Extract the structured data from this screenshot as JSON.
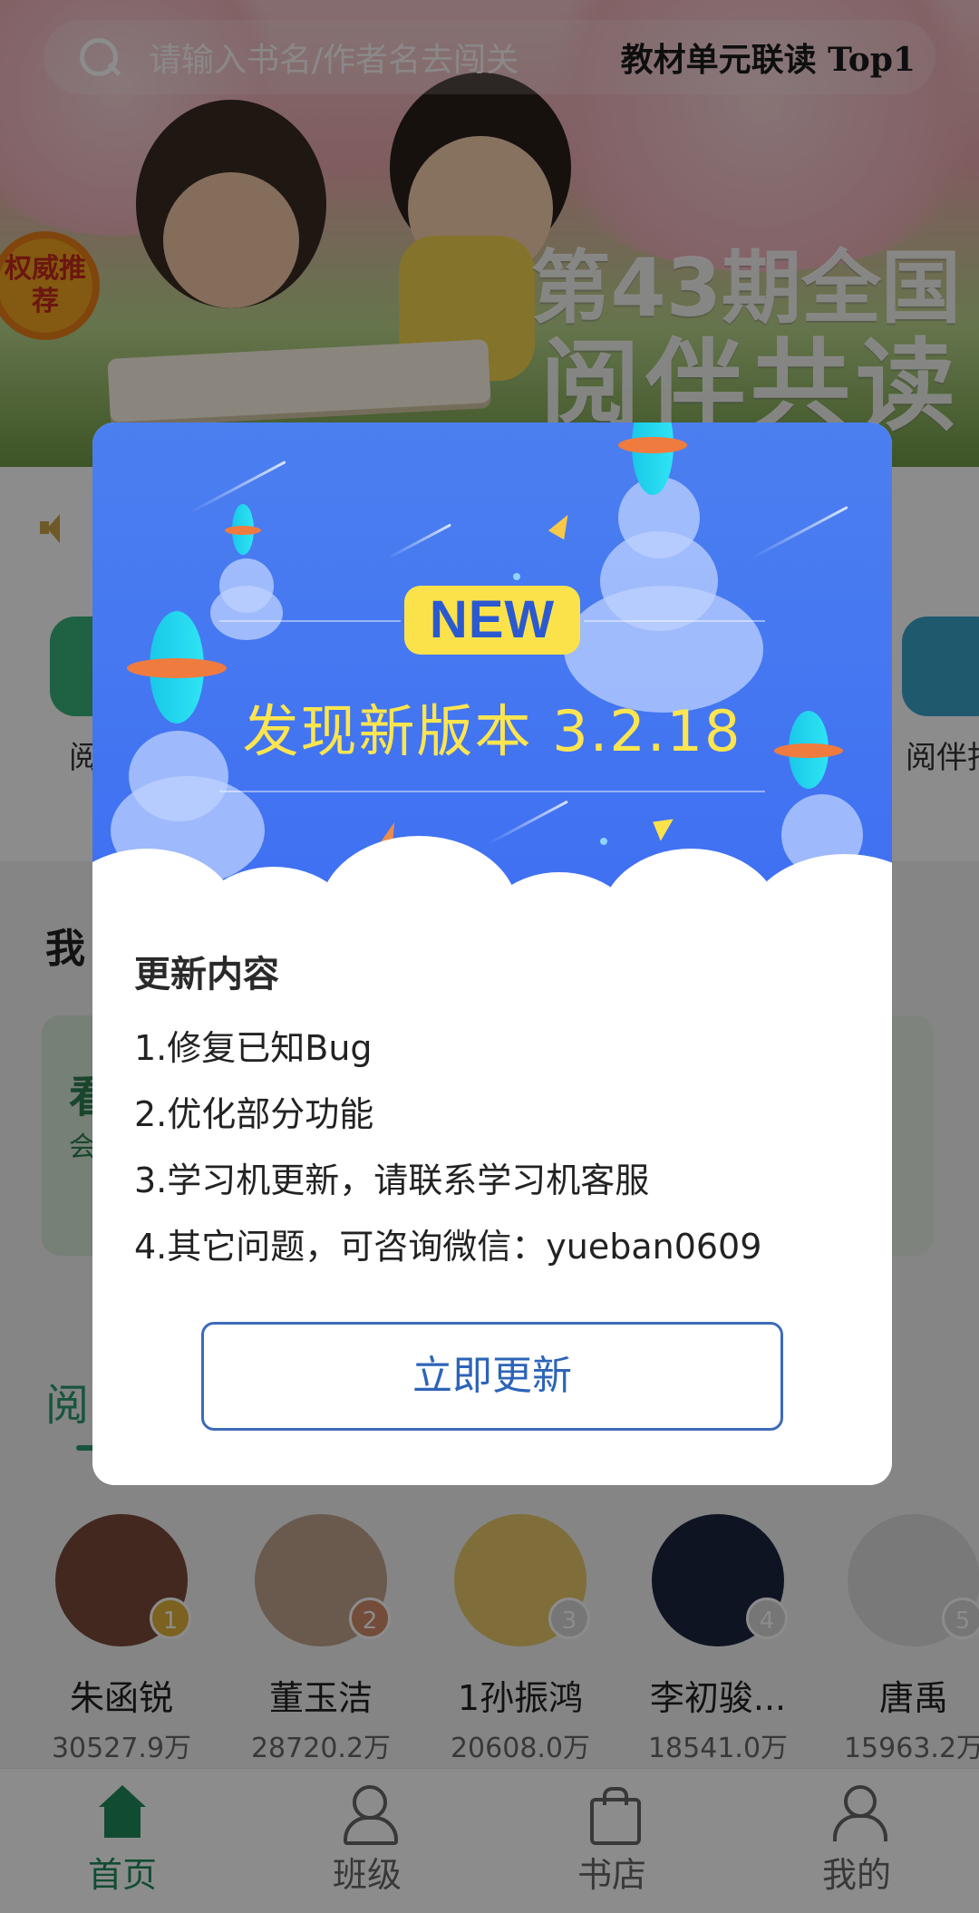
{
  "search": {
    "placeholder": "请输入书名/作者名去闯关",
    "hot_text": "教材单元联读 Top1"
  },
  "banner": {
    "badge": "权威推荐",
    "title_line1": "第43期全国",
    "title_line2": "阅伴共读"
  },
  "shortcuts": [
    {
      "label": "阅伴",
      "icon": "reading-icon",
      "color": "#39b27a"
    },
    {
      "label": "阅伴指",
      "icon": "guide-icon",
      "color": "#3aa2c9"
    }
  ],
  "section": {
    "title": "我",
    "card_text": "看",
    "card_sub": "会"
  },
  "rank_tab": "阅",
  "ranks": [
    {
      "rank": "1",
      "name": "朱函锐",
      "score": "30527.9万",
      "badge_color": "#e2b23b"
    },
    {
      "rank": "2",
      "name": "董玉洁",
      "score": "28720.2万",
      "badge_color": "#d28a6a"
    },
    {
      "rank": "3",
      "name": "1孙振鸿",
      "score": "20608.0万",
      "badge_color": "#bdbdbd"
    },
    {
      "rank": "4",
      "name": "李初骏...",
      "score": "18541.0万",
      "badge_color": "#bdbdbd"
    },
    {
      "rank": "5",
      "name": "唐禹",
      "score": "15963.2万",
      "badge_color": "#bdbdbd"
    }
  ],
  "tabbar": [
    {
      "label": "首页",
      "icon": "home-icon",
      "active": true
    },
    {
      "label": "班级",
      "icon": "class-icon",
      "active": false
    },
    {
      "label": "书店",
      "icon": "store-icon",
      "active": false
    },
    {
      "label": "我的",
      "icon": "me-icon",
      "active": false
    }
  ],
  "dialog": {
    "badge": "NEW",
    "title": "发现新版本 3.2.18",
    "content_title": "更新内容",
    "lines": [
      "1.修复已知Bug",
      "2.优化部分功能",
      "3.学习机更新，请联系学习机客服",
      "4.其它问题，可咨询微信：yueban0609"
    ],
    "button": "立即更新"
  },
  "colors": {
    "brand_green": "#1f8a5b",
    "dialog_blue": "#3e6ff2",
    "badge_yellow": "#fbe24b",
    "button_blue": "#2d64b8"
  }
}
